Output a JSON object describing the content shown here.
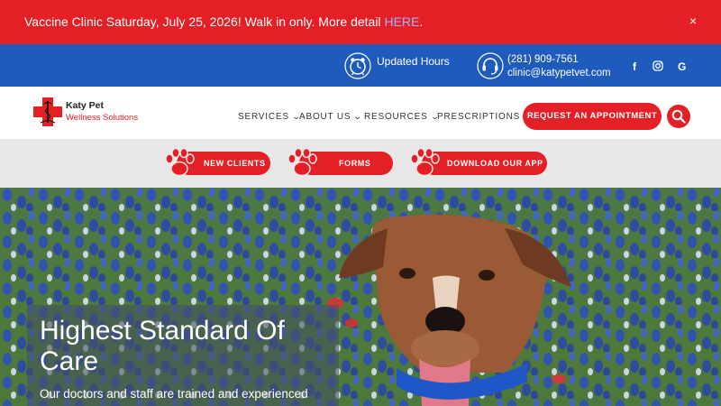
{
  "alert": {
    "message": "Vaccine Clinic Saturday, July 25, 2026! Walk in only. More detail ",
    "link_text": "HERE",
    "suffix": ".",
    "close_label": "×"
  },
  "topbar": {
    "hours_label": "Updated Hours",
    "phone": "(281) 909-7561",
    "email": "clinic@katypetvet.com",
    "social": [
      {
        "icon": "facebook-icon",
        "glyph": "f"
      },
      {
        "icon": "instagram-icon",
        "glyph": "◻"
      },
      {
        "icon": "google-icon",
        "glyph": "G"
      }
    ]
  },
  "logo": {
    "name": "Katy Pet",
    "subtitle": "Wellness Solutions"
  },
  "nav": {
    "items": [
      {
        "label": "SERVICES"
      },
      {
        "label": "ABOUT US"
      },
      {
        "label": "RESOURCES"
      },
      {
        "label": "PRESCRIPTIONS"
      }
    ],
    "appointment_label": "REQUEST AN APPOINTMENT"
  },
  "actions": [
    {
      "label": "NEW CLIENTS"
    },
    {
      "label": "FORMS"
    },
    {
      "label": "DOWNLOAD OUR APP"
    }
  ],
  "hero": {
    "title": "Highest Standard Of Care",
    "text": "Our doctors and staff are trained and experienced"
  },
  "colors": {
    "brand_red": "#e42026",
    "brand_blue": "#1e5bbd",
    "link_blue": "#9bb6ff",
    "action_gray": "#e7e7e7"
  }
}
